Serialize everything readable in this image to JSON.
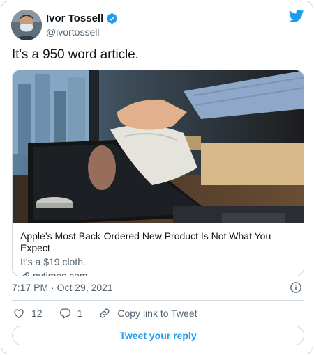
{
  "author": {
    "display_name": "Ivor Tossell",
    "handle": "@ivortossell",
    "verified": true,
    "avatar_icon": "avatar-photo-masked-man"
  },
  "tweet": {
    "text": "It's a 950 word article.",
    "timestamp": "7:17 PM · Oct 29, 2021"
  },
  "link_card": {
    "image_icon": "hand-wiping-laptop-with-cloth-photo",
    "title": "Apple’s Most Back-Ordered New Product Is Not What You Expect",
    "description": "It’s a $19 cloth.",
    "domain": "nytimes.com"
  },
  "actions": {
    "likes": "12",
    "replies": "1",
    "copy_link_label": "Copy link to Tweet"
  },
  "reply_button": {
    "label": "Tweet your reply"
  },
  "colors": {
    "accent": "#1d9bf0",
    "text_primary": "#0f1419",
    "text_secondary": "#536471",
    "border": "#cfd9de"
  }
}
